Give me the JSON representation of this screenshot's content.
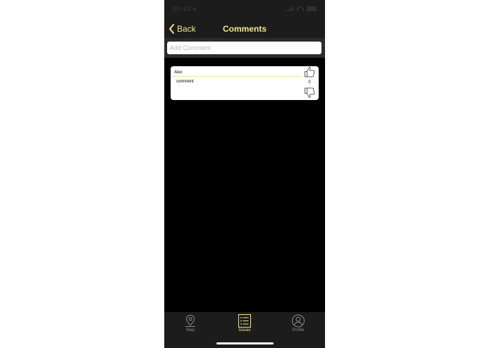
{
  "status_bar": {
    "time": "09:43 ▾"
  },
  "nav": {
    "back_label": "Back",
    "title": "Comments"
  },
  "comment_input": {
    "placeholder": "Add Comment",
    "value": ""
  },
  "comments": [
    {
      "author": "Alex",
      "text": "comment",
      "votes": "0"
    }
  ],
  "tabs": [
    {
      "label": "Map",
      "icon": "map-pin-icon",
      "active": false
    },
    {
      "label": "Issues",
      "icon": "list-icon",
      "active": true
    },
    {
      "label": "Profile",
      "icon": "user-icon",
      "active": false
    }
  ],
  "colors": {
    "accent": "#f3e58a",
    "inactive": "#8a8a8a",
    "background": "#000000",
    "bar": "#1c1c1c"
  }
}
